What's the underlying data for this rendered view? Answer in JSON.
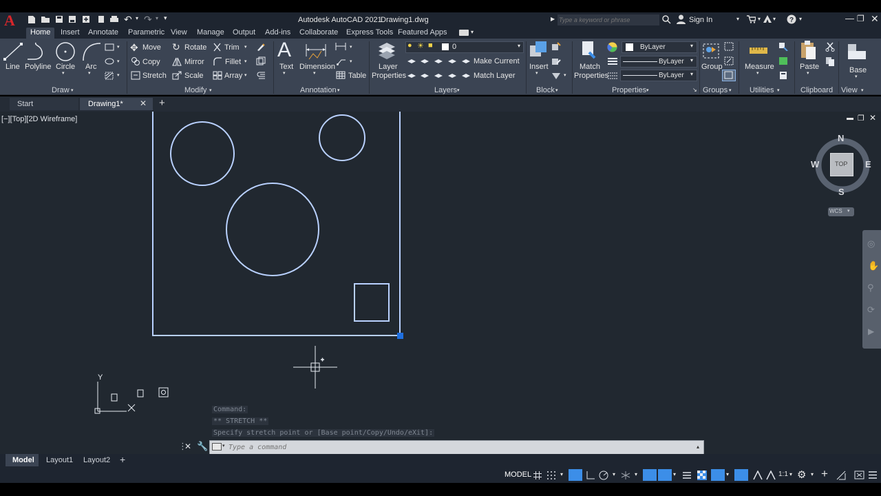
{
  "app": {
    "title": "Autodesk AutoCAD 2021",
    "file": "Drawing1.dwg",
    "search_placeholder": "Type a keyword or phrase",
    "sign_in": "Sign In",
    "logo_letter": "A"
  },
  "ribbon_tabs": [
    "Home",
    "Insert",
    "Annotate",
    "Parametric",
    "View",
    "Manage",
    "Output",
    "Add-ins",
    "Collaborate",
    "Express Tools",
    "Featured Apps"
  ],
  "ribbon": {
    "draw": {
      "panel": "Draw",
      "line": "Line",
      "polyline": "Polyline",
      "circle": "Circle",
      "arc": "Arc"
    },
    "modify": {
      "panel": "Modify",
      "move": "Move",
      "rotate": "Rotate",
      "trim": "Trim",
      "copy": "Copy",
      "mirror": "Mirror",
      "fillet": "Fillet",
      "stretch": "Stretch",
      "scale": "Scale",
      "array": "Array"
    },
    "annotation": {
      "panel": "Annotation",
      "text": "Text",
      "dimension": "Dimension",
      "table": "Table"
    },
    "layers": {
      "panel": "Layers",
      "layer_properties_1": "Layer",
      "layer_properties_2": "Properties",
      "current_layer": "0",
      "make_current": "Make Current",
      "match_layer": "Match Layer"
    },
    "block": {
      "panel": "Block",
      "insert": "Insert"
    },
    "properties": {
      "panel": "Properties",
      "match_1": "Match",
      "match_2": "Properties",
      "color": "ByLayer",
      "linetype": "ByLayer",
      "lineweight": "ByLayer"
    },
    "groups": {
      "panel": "Groups",
      "group": "Group"
    },
    "utilities": {
      "panel": "Utilities",
      "measure": "Measure"
    },
    "clipboard": {
      "panel": "Clipboard",
      "paste": "Paste"
    },
    "view": {
      "panel": "View",
      "base": "Base"
    }
  },
  "doc_tabs": {
    "start": "Start",
    "drawing": "Drawing1*"
  },
  "viewport": {
    "label": "[−][Top][2D Wireframe]",
    "viewcube": {
      "n": "N",
      "s": "S",
      "e": "E",
      "w": "W",
      "top": "TOP",
      "wcs": "WCS"
    },
    "ucs_y": "Y",
    "ucs_x": "X"
  },
  "command": {
    "history": [
      "Command:",
      "** STRETCH **",
      "Specify stretch point or [Base point/Copy/Undo/eXit]:"
    ],
    "placeholder": "Type a command"
  },
  "layout_tabs": [
    "Model",
    "Layout1",
    "Layout2"
  ],
  "status": {
    "model": "MODEL",
    "scale": "1:1"
  },
  "colors": {
    "accent": "#3c8ee8",
    "geometry": "#b9d1ff",
    "grip": "#1f6fe0"
  }
}
